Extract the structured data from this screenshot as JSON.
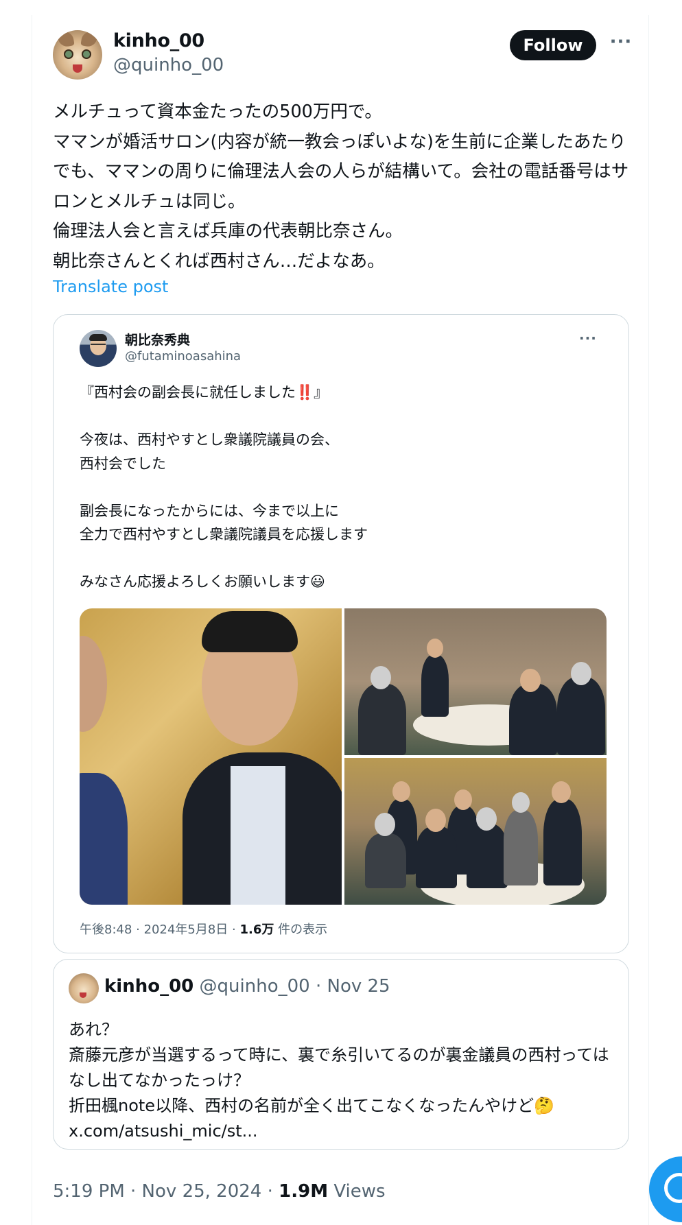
{
  "post": {
    "display_name": "kinho_00",
    "handle": "@quinho_00",
    "follow_label": "Follow",
    "more_label": "···",
    "text": "メルチュって資本金たったの500万円で。\nママンが婚活サロン(内容が統一教会っぽいよな)を生前に企業したあたりでも、ママンの周りに倫理法人会の人らが結構いて。会社の電話番号はサロンとメルチュは同じ。\n倫理法人会と言えば兵庫の代表朝比奈さん。\n朝比奈さんとくれば西村さん…だよなあ。",
    "translate_label": "Translate post",
    "time": "5:19 PM · Nov 25, 2024 · ",
    "views_count": "1.9M",
    "views_label": " Views"
  },
  "quoted_post": {
    "display_name": "朝比奈秀典",
    "handle": "@futaminoasahina",
    "more_label": "···",
    "text": "『西村会の副会長に就任しました‼️』\n\n今夜は、西村やすとし衆議院議員の会、\n西村会でした\n\n副会長になったからには、今まで以上に\n全力で西村やすとし衆議院議員を応援します\n\nみなさん応援よろしくお願いします😃",
    "meta_time": "午後8:48 · 2024年5月8日 · ",
    "meta_views": "1.6万",
    "meta_views_label": " 件の表示"
  },
  "quoted_post_2": {
    "display_name": "kinho_00",
    "handle_date": " @quinho_00 · Nov 25",
    "text": "あれ？\n斎藤元彦が当選するって時に、裏で糸引いてるのが裏金議員の西村ってはなし出てなかったっけ？\n折田楓note以降、西村の名前が全く出てこなくなったんやけど🤔\nx.com/atsushi_mic/st..."
  },
  "colors": {
    "accent": "#1d9bf0",
    "text": "#0f1419",
    "secondary": "#536471",
    "border": "#cfd9de"
  }
}
